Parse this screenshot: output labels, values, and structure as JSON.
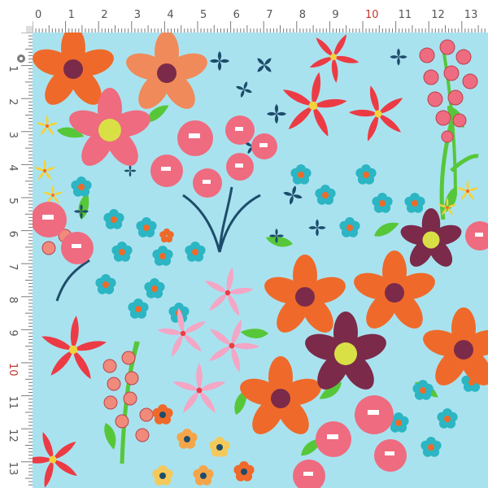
{
  "colors": {
    "background": "#a9e2ef",
    "ruler_bg": "#ffffff",
    "ruler_tick": "#7a7a7a",
    "ruler_label": "#555555",
    "ruler_label_highlight": "#c0392b",
    "orange": "#ef6a2a",
    "peach": "#f08a5a",
    "pink": "#ef6b7f",
    "red": "#ec3b44",
    "teal": "#2cb5c3",
    "navy": "#1e4d6b",
    "plum": "#7b2a4a",
    "light_pink": "#f4a6c5",
    "green": "#57c73a",
    "yellow": "#f4d23c"
  },
  "ruler": {
    "top_labels": [
      "0",
      "1",
      "2",
      "3",
      "4",
      "5",
      "6",
      "7",
      "8",
      "9",
      "10",
      "11",
      "12",
      "13"
    ],
    "left_labels": [
      "1",
      "2",
      "3",
      "4",
      "5",
      "6",
      "7",
      "8",
      "9",
      "10",
      "11",
      "12",
      "13"
    ],
    "highlight_label": "10",
    "unit": "cm"
  },
  "pattern": {
    "motifs": [
      "orange-flower",
      "peach-flower",
      "plum-flower",
      "pink-poppy",
      "red-star-flower",
      "teal-flower",
      "navy-sprig",
      "light-pink-star-flower",
      "yellow-star-flower",
      "pink-berry-stem"
    ]
  }
}
